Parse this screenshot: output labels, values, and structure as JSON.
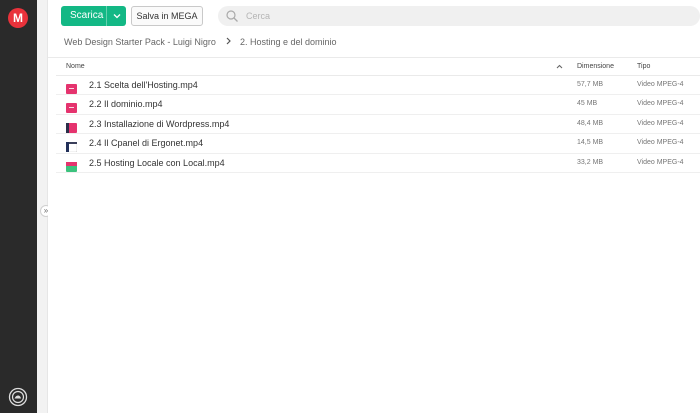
{
  "app": {
    "logo_letter": "M",
    "colors": {
      "brand": "#e9323b",
      "accent": "#13b885"
    }
  },
  "toolbar": {
    "download_label": "Scarica",
    "save_label": "Salva in MEGA"
  },
  "search": {
    "placeholder": "Cerca"
  },
  "breadcrumb": {
    "root": "Web Design Starter Pack - Luigi Nigro",
    "current": "2. Hosting e del dominio"
  },
  "table": {
    "headers": {
      "name": "Nome",
      "size": "Dimensione",
      "type": "Tipo"
    },
    "rows": [
      {
        "name": "2.1 Scelta dell'Hosting.mp4",
        "size": "57,7 MB",
        "type": "Video MPEG-4",
        "thumb": "pink"
      },
      {
        "name": "2.2 Il dominio.mp4",
        "size": "45 MB",
        "type": "Video MPEG-4",
        "thumb": "pink"
      },
      {
        "name": "2.3 Installazione di Wordpress.mp4",
        "size": "48,4 MB",
        "type": "Video MPEG-4",
        "thumb": "pink-dark"
      },
      {
        "name": "2.4 Il Cpanel di Ergonet.mp4",
        "size": "14,5 MB",
        "type": "Video MPEG-4",
        "thumb": "dark"
      },
      {
        "name": "2.5 Hosting Locale con Local.mp4",
        "size": "33,2 MB",
        "type": "Video MPEG-4",
        "thumb": "green"
      }
    ]
  }
}
